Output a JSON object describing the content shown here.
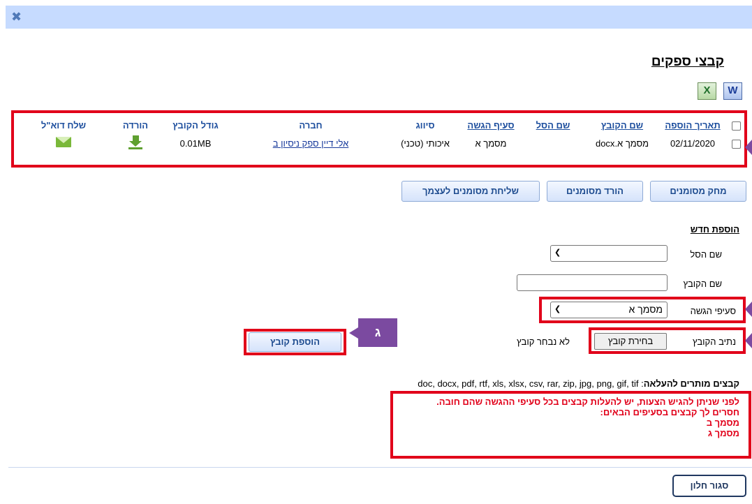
{
  "title": "קבצי ספקים",
  "icons": {
    "close": "close-icon",
    "excel": "excel-icon",
    "word": "word-icon",
    "mail": "envelope-icon",
    "download": "download-icon"
  },
  "table": {
    "headers": [
      "תאריך הוספה",
      "שם הקובץ",
      "שם הסל",
      "סעיף הגשה",
      "סיווג",
      "חברה",
      "גודל הקובץ",
      "הורדה",
      "שלח דוא\"ל"
    ],
    "rows": [
      {
        "date": "02/11/2020",
        "file": "מסמך א.docx",
        "basket": "",
        "section": "מסמך א",
        "classification": "איכותי (טכני)",
        "company": "אלי דיין ספק ניסיון ב",
        "size": "0.01MB"
      }
    ]
  },
  "buttons": {
    "delete": "מחק מסומנים",
    "download": "הורד מסומנים",
    "send_self": "שליחת מסומנים לעצמך",
    "add_file": "הוספת קובץ",
    "close": "סגור חלון"
  },
  "form": {
    "title": "הוספת חדש",
    "basket_label": "שם הסל",
    "basket_value": "",
    "filename_label": "שם הקובץ",
    "filename_value": "",
    "section_label": "סעיפי הגשה",
    "section_value": "מסמך א",
    "path_label": "נתיב הקובץ",
    "choose_file": "בחירת קובץ",
    "no_file": "לא נבחר קובץ"
  },
  "tag_label": "ג",
  "allowed": {
    "label": "קבצים מותרים להעלאה",
    "types": "doc, docx, pdf, rtf, xls, xlsx, csv, rar, zip, jpg, png, gif, tif"
  },
  "warning": {
    "line1": "לפני שניתן להגיש הצעות, יש להעלות קבצים בכל סעיפי ההגשה שהם חובה.",
    "line2": "חסרים לך קבצים בסעיפים הבאים:",
    "items": [
      "מסמך ב",
      "מסמך ג"
    ]
  },
  "colors": {
    "highlight": "#e1001a",
    "callout": "#7b4aa0",
    "header_bar": "#c6dbff",
    "link": "#1a3c9c"
  }
}
